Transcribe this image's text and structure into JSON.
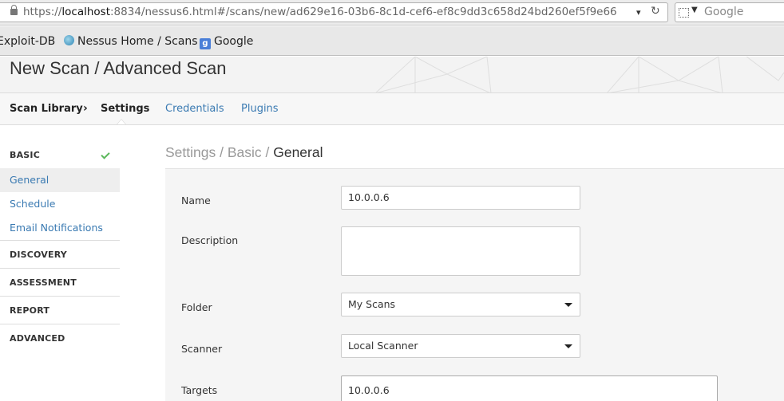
{
  "browser": {
    "url_prefix": "https://",
    "url_host": "localhost",
    "url_rest": ":8834/nessus6.html#/scans/new/ad629e16-03b6-8c1d-cef6-ef8c9dd3c658d24bd260ef5f9e66",
    "search_placeholder": "Google"
  },
  "bookmarks": [
    {
      "label": "Exploit-DB"
    },
    {
      "label": "Nessus Home / Scans",
      "icon": "nessus-icon"
    },
    {
      "label": "Google",
      "icon": "google-icon"
    }
  ],
  "header": {
    "title": "New Scan / Advanced Scan"
  },
  "tabs": {
    "scan_library": "Scan Library",
    "separator": "›",
    "settings": "Settings",
    "credentials": "Credentials",
    "plugins": "Plugins"
  },
  "sidebar": {
    "basic": "BASIC",
    "items": [
      "General",
      "Schedule",
      "Email Notifications"
    ],
    "discovery": "DISCOVERY",
    "assessment": "ASSESSMENT",
    "report": "REPORT",
    "advanced": "ADVANCED"
  },
  "main": {
    "crumb_settings": "Settings",
    "crumb_sep": " / ",
    "crumb_basic": "Basic",
    "crumb_current": "General"
  },
  "form": {
    "name_label": "Name",
    "name_value": "10.0.0.6",
    "description_label": "Description",
    "description_value": "",
    "folder_label": "Folder",
    "folder_value": "My Scans",
    "scanner_label": "Scanner",
    "scanner_value": "Local Scanner",
    "targets_label": "Targets",
    "targets_value": "10.0.0.6"
  },
  "colors": {
    "link": "#3a7ab2",
    "check": "#5cb85c"
  }
}
